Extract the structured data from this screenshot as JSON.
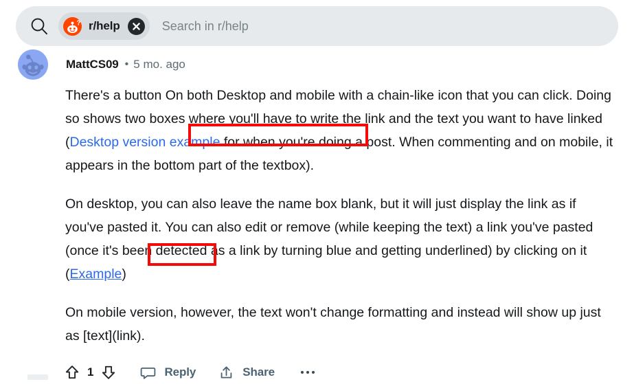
{
  "search": {
    "search_icon": "search-icon",
    "chip": {
      "avatar_icon": "reddit-help-snoo-icon",
      "label": "r/help",
      "close_icon": "close-icon"
    },
    "placeholder": "Search in r/help"
  },
  "comment": {
    "avatar_icon": "user-avatar-snoo-icon",
    "author": "MattCS09",
    "separator": "•",
    "timestamp": "5 mo. ago",
    "paragraphs": [
      {
        "segments": [
          {
            "type": "text",
            "text": "There's a button On both Desktop and mobile with a chain-like icon that you can click. Doing so shows two boxes where you'll have to write the link and the text you want to have linked "
          },
          {
            "type": "text",
            "text": "("
          },
          {
            "type": "link",
            "text": "Desktop version example"
          },
          {
            "type": "text",
            "text": " for when you're doing a post. When commenting and on mobile, it appears in the bottom part of the textbox)."
          }
        ]
      },
      {
        "segments": [
          {
            "type": "text",
            "text": "On desktop, you can also leave the name box blank, but it will just display the link as if you've pasted it. You can also edit or remove (while keeping the text) a link you've pasted (once it's been detected as a link by turning blue and getting underlined) by clicking on it "
          },
          {
            "type": "text",
            "text": "("
          },
          {
            "type": "link",
            "text": "Example"
          },
          {
            "type": "text",
            "text": ")"
          }
        ]
      },
      {
        "segments": [
          {
            "type": "text",
            "text": "On mobile version, however, the text won't change formatting and instead will show up just as [text](link)."
          }
        ]
      }
    ],
    "actions": {
      "upvote_icon": "upvote-arrow-icon",
      "vote_count": "1",
      "downvote_icon": "downvote-arrow-icon",
      "reply_icon": "comment-bubble-icon",
      "reply_label": "Reply",
      "share_icon": "share-arrow-icon",
      "share_label": "Share",
      "more_icon": "more-horizontal-icon"
    }
  },
  "colors": {
    "link": "#2a6ae8",
    "annotation_red": "#f50a0a",
    "reddit_orange": "#ff4500",
    "searchbar_bg": "#e7eaec",
    "chip_bg": "#d6dbdf",
    "action_text": "#4a6272",
    "meta_text": "#5c6c74"
  }
}
